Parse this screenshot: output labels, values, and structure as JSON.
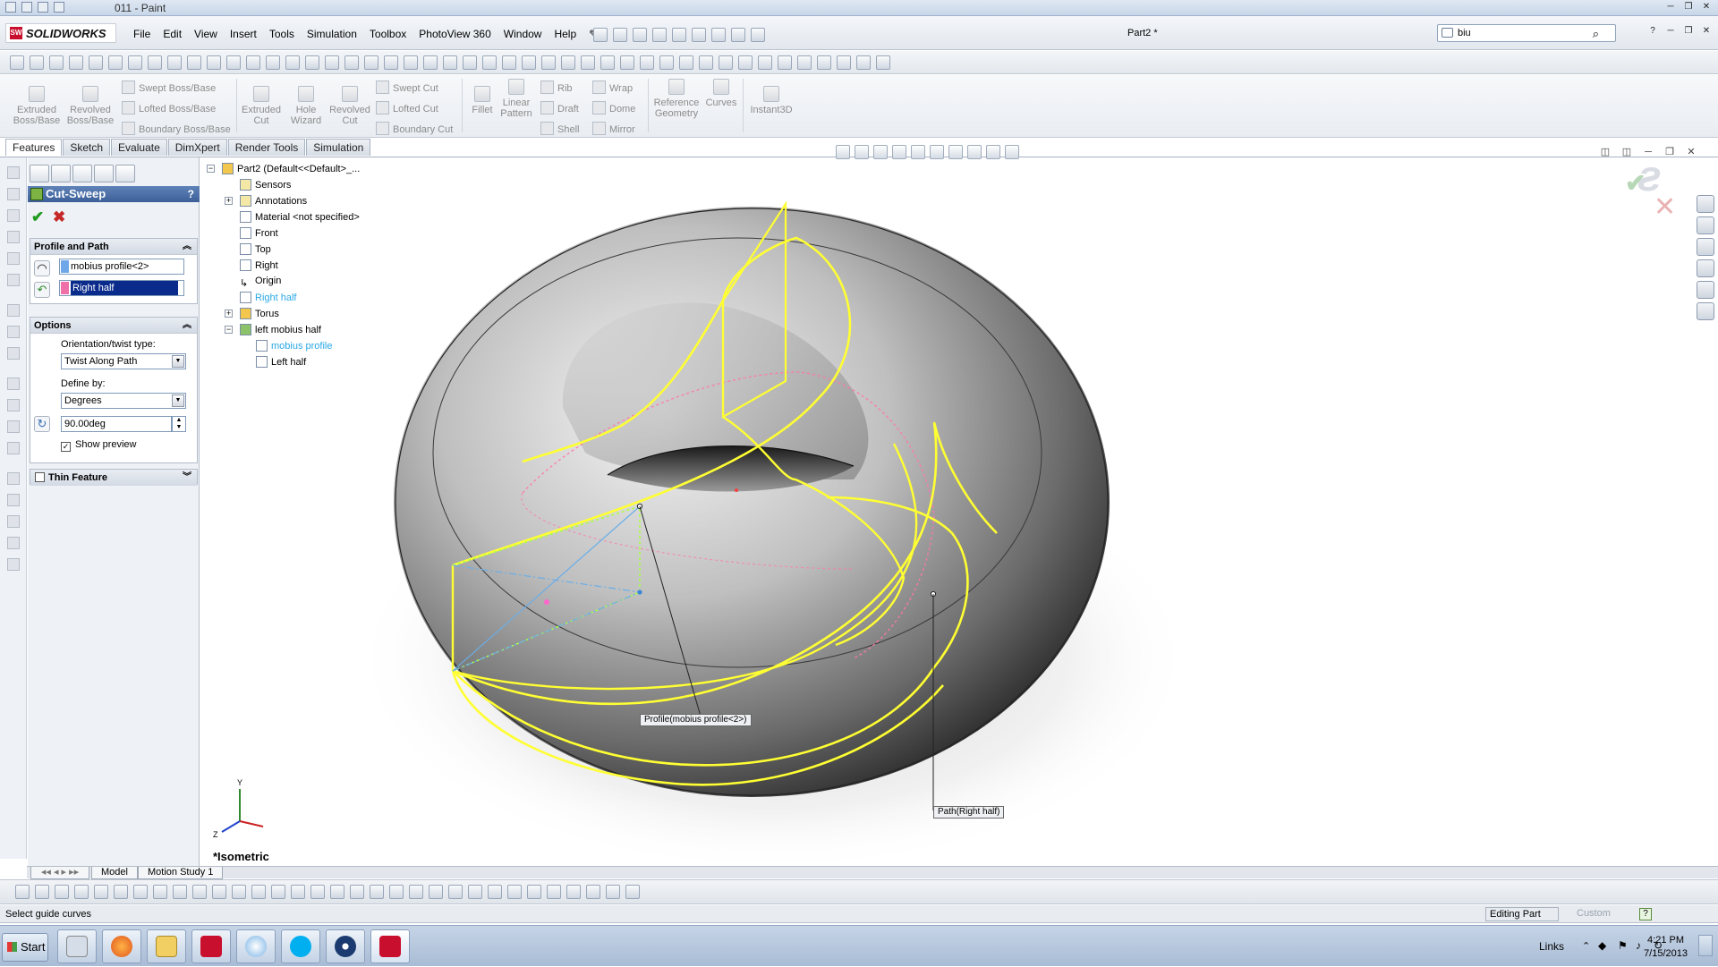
{
  "outer_window": {
    "title": "011 - Paint"
  },
  "app": {
    "logo_text": "SOLIDWORKS",
    "document_title": "Part2 *"
  },
  "menu": [
    "File",
    "Edit",
    "View",
    "Insert",
    "Tools",
    "Simulation",
    "Toolbox",
    "PhotoView 360",
    "Window",
    "Help"
  ],
  "search": {
    "value": "biu"
  },
  "command_manager": {
    "extruded_boss": "Extruded Boss/Base",
    "revolved_boss": "Revolved Boss/Base",
    "swept_boss": "Swept Boss/Base",
    "lofted_boss": "Lofted Boss/Base",
    "boundary_boss": "Boundary Boss/Base",
    "extruded_cut": "Extruded Cut",
    "hole_wizard": "Hole Wizard",
    "revolved_cut": "Revolved Cut",
    "swept_cut": "Swept Cut",
    "lofted_cut": "Lofted Cut",
    "boundary_cut": "Boundary Cut",
    "fillet": "Fillet",
    "linear_pattern": "Linear Pattern",
    "rib": "Rib",
    "draft": "Draft",
    "shell": "Shell",
    "wrap": "Wrap",
    "dome": "Dome",
    "mirror": "Mirror",
    "reference_geometry": "Reference Geometry",
    "curves": "Curves",
    "instant3d": "Instant3D"
  },
  "tabs": [
    "Features",
    "Sketch",
    "Evaluate",
    "DimXpert",
    "Render Tools",
    "Simulation"
  ],
  "property_manager": {
    "title": "Cut-Sweep",
    "help": "?",
    "profile_and_path": {
      "heading": "Profile and Path",
      "profile_value": "mobius profile<2>",
      "path_value": "Right half"
    },
    "options": {
      "heading": "Options",
      "orientation_label": "Orientation/twist type:",
      "orientation_value": "Twist Along Path",
      "define_by_label": "Define by:",
      "define_by_value": "Degrees",
      "angle_value": "90.00deg",
      "show_preview_label": "Show preview",
      "show_preview_checked": true
    },
    "thin_feature": {
      "heading": "Thin Feature"
    }
  },
  "feature_tree": {
    "root": "Part2  (Default<<Default>_...",
    "items": [
      "Sensors",
      "Annotations",
      "Material <not specified>",
      "Front",
      "Top",
      "Right",
      "Origin",
      "Right half",
      "Torus",
      "left mobius half",
      "mobius profile",
      "Left half"
    ]
  },
  "viewport": {
    "view_name": "*Isometric",
    "callout_profile": "Profile(mobius profile<2>)",
    "callout_path": "Path(Right half)",
    "preview_color": "#ffff33"
  },
  "bottom_tabs": [
    "Model",
    "Motion Study 1"
  ],
  "status": {
    "message": "Select guide curves",
    "mode": "Editing Part",
    "units": "Custom"
  },
  "taskbar": {
    "start": "Start",
    "links": "Links",
    "time": "4:21 PM",
    "date": "7/15/2013"
  }
}
